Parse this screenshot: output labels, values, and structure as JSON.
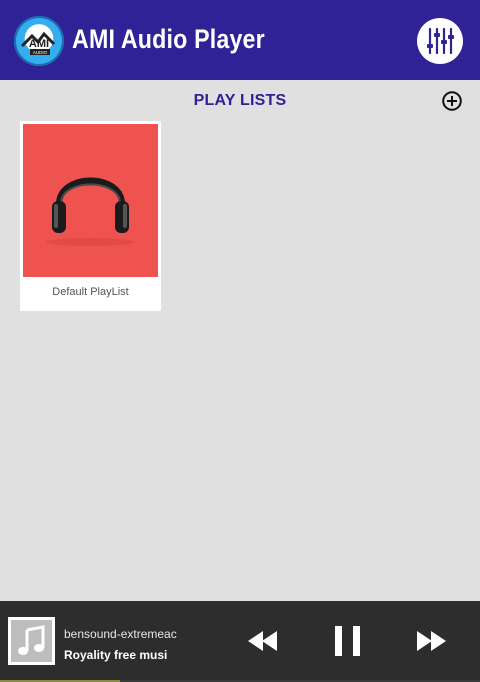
{
  "app": {
    "title": "AMI Audio Player",
    "logo_text": "AMI AUDIO",
    "icons": {
      "logo": "ami-logo-icon",
      "equalizer": "equalizer-icon"
    }
  },
  "playlists": {
    "heading": "PLAY LISTS",
    "add_icon": "add-circle-icon",
    "items": [
      {
        "name": "Default PlayList",
        "art_icon": "headphones-icon",
        "art_color": "#ef5350"
      }
    ]
  },
  "now_playing": {
    "title": "bensound-extremeac",
    "subtitle": "Royality free musi",
    "thumb_icon": "music-note-icon",
    "progress": 0.25,
    "controls": {
      "previous": "rewind-icon",
      "toggle": "pause-icon",
      "next": "fast-forward-icon"
    }
  },
  "colors": {
    "appbar": "#2f2196",
    "background": "#e0e0e0",
    "player_bar": "#2d2d2d",
    "accent": "#2f2196"
  }
}
